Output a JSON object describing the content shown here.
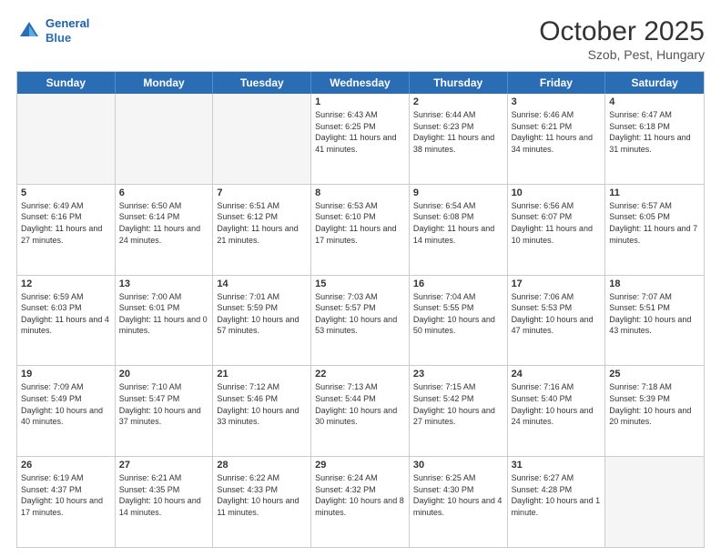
{
  "header": {
    "logo_line1": "General",
    "logo_line2": "Blue",
    "month": "October 2025",
    "location": "Szob, Pest, Hungary"
  },
  "day_headers": [
    "Sunday",
    "Monday",
    "Tuesday",
    "Wednesday",
    "Thursday",
    "Friday",
    "Saturday"
  ],
  "weeks": [
    [
      {
        "num": "",
        "info": "",
        "empty": true
      },
      {
        "num": "",
        "info": "",
        "empty": true
      },
      {
        "num": "",
        "info": "",
        "empty": true
      },
      {
        "num": "1",
        "info": "Sunrise: 6:43 AM\nSunset: 6:25 PM\nDaylight: 11 hours\nand 41 minutes.",
        "empty": false
      },
      {
        "num": "2",
        "info": "Sunrise: 6:44 AM\nSunset: 6:23 PM\nDaylight: 11 hours\nand 38 minutes.",
        "empty": false
      },
      {
        "num": "3",
        "info": "Sunrise: 6:46 AM\nSunset: 6:21 PM\nDaylight: 11 hours\nand 34 minutes.",
        "empty": false
      },
      {
        "num": "4",
        "info": "Sunrise: 6:47 AM\nSunset: 6:18 PM\nDaylight: 11 hours\nand 31 minutes.",
        "empty": false
      }
    ],
    [
      {
        "num": "5",
        "info": "Sunrise: 6:49 AM\nSunset: 6:16 PM\nDaylight: 11 hours\nand 27 minutes.",
        "empty": false
      },
      {
        "num": "6",
        "info": "Sunrise: 6:50 AM\nSunset: 6:14 PM\nDaylight: 11 hours\nand 24 minutes.",
        "empty": false
      },
      {
        "num": "7",
        "info": "Sunrise: 6:51 AM\nSunset: 6:12 PM\nDaylight: 11 hours\nand 21 minutes.",
        "empty": false
      },
      {
        "num": "8",
        "info": "Sunrise: 6:53 AM\nSunset: 6:10 PM\nDaylight: 11 hours\nand 17 minutes.",
        "empty": false
      },
      {
        "num": "9",
        "info": "Sunrise: 6:54 AM\nSunset: 6:08 PM\nDaylight: 11 hours\nand 14 minutes.",
        "empty": false
      },
      {
        "num": "10",
        "info": "Sunrise: 6:56 AM\nSunset: 6:07 PM\nDaylight: 11 hours\nand 10 minutes.",
        "empty": false
      },
      {
        "num": "11",
        "info": "Sunrise: 6:57 AM\nSunset: 6:05 PM\nDaylight: 11 hours\nand 7 minutes.",
        "empty": false
      }
    ],
    [
      {
        "num": "12",
        "info": "Sunrise: 6:59 AM\nSunset: 6:03 PM\nDaylight: 11 hours\nand 4 minutes.",
        "empty": false
      },
      {
        "num": "13",
        "info": "Sunrise: 7:00 AM\nSunset: 6:01 PM\nDaylight: 11 hours\nand 0 minutes.",
        "empty": false
      },
      {
        "num": "14",
        "info": "Sunrise: 7:01 AM\nSunset: 5:59 PM\nDaylight: 10 hours\nand 57 minutes.",
        "empty": false
      },
      {
        "num": "15",
        "info": "Sunrise: 7:03 AM\nSunset: 5:57 PM\nDaylight: 10 hours\nand 53 minutes.",
        "empty": false
      },
      {
        "num": "16",
        "info": "Sunrise: 7:04 AM\nSunset: 5:55 PM\nDaylight: 10 hours\nand 50 minutes.",
        "empty": false
      },
      {
        "num": "17",
        "info": "Sunrise: 7:06 AM\nSunset: 5:53 PM\nDaylight: 10 hours\nand 47 minutes.",
        "empty": false
      },
      {
        "num": "18",
        "info": "Sunrise: 7:07 AM\nSunset: 5:51 PM\nDaylight: 10 hours\nand 43 minutes.",
        "empty": false
      }
    ],
    [
      {
        "num": "19",
        "info": "Sunrise: 7:09 AM\nSunset: 5:49 PM\nDaylight: 10 hours\nand 40 minutes.",
        "empty": false
      },
      {
        "num": "20",
        "info": "Sunrise: 7:10 AM\nSunset: 5:47 PM\nDaylight: 10 hours\nand 37 minutes.",
        "empty": false
      },
      {
        "num": "21",
        "info": "Sunrise: 7:12 AM\nSunset: 5:46 PM\nDaylight: 10 hours\nand 33 minutes.",
        "empty": false
      },
      {
        "num": "22",
        "info": "Sunrise: 7:13 AM\nSunset: 5:44 PM\nDaylight: 10 hours\nand 30 minutes.",
        "empty": false
      },
      {
        "num": "23",
        "info": "Sunrise: 7:15 AM\nSunset: 5:42 PM\nDaylight: 10 hours\nand 27 minutes.",
        "empty": false
      },
      {
        "num": "24",
        "info": "Sunrise: 7:16 AM\nSunset: 5:40 PM\nDaylight: 10 hours\nand 24 minutes.",
        "empty": false
      },
      {
        "num": "25",
        "info": "Sunrise: 7:18 AM\nSunset: 5:39 PM\nDaylight: 10 hours\nand 20 minutes.",
        "empty": false
      }
    ],
    [
      {
        "num": "26",
        "info": "Sunrise: 6:19 AM\nSunset: 4:37 PM\nDaylight: 10 hours\nand 17 minutes.",
        "empty": false
      },
      {
        "num": "27",
        "info": "Sunrise: 6:21 AM\nSunset: 4:35 PM\nDaylight: 10 hours\nand 14 minutes.",
        "empty": false
      },
      {
        "num": "28",
        "info": "Sunrise: 6:22 AM\nSunset: 4:33 PM\nDaylight: 10 hours\nand 11 minutes.",
        "empty": false
      },
      {
        "num": "29",
        "info": "Sunrise: 6:24 AM\nSunset: 4:32 PM\nDaylight: 10 hours\nand 8 minutes.",
        "empty": false
      },
      {
        "num": "30",
        "info": "Sunrise: 6:25 AM\nSunset: 4:30 PM\nDaylight: 10 hours\nand 4 minutes.",
        "empty": false
      },
      {
        "num": "31",
        "info": "Sunrise: 6:27 AM\nSunset: 4:28 PM\nDaylight: 10 hours\nand 1 minute.",
        "empty": false
      },
      {
        "num": "",
        "info": "",
        "empty": true
      }
    ]
  ]
}
